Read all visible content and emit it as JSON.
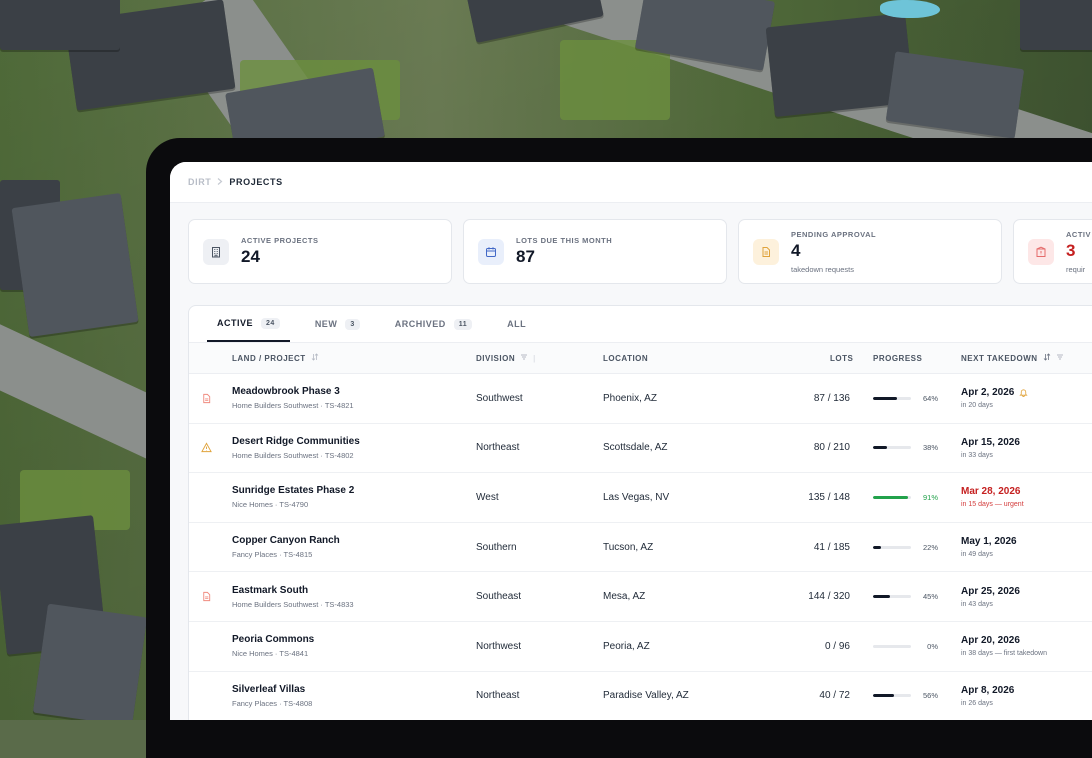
{
  "breadcrumb": {
    "root": "DIRT",
    "current": "PROJECTS"
  },
  "stats": [
    {
      "label": "ACTIVE PROJECTS",
      "value": "24",
      "sub": "",
      "icon": "building-icon"
    },
    {
      "label": "LOTS DUE THIS MONTH",
      "value": "87",
      "sub": "",
      "icon": "calendar-icon"
    },
    {
      "label": "PENDING APPROVAL",
      "value": "4",
      "sub": "takedown requests",
      "icon": "document-icon"
    },
    {
      "label": "ACTIV",
      "value": "3",
      "sub": "requir",
      "icon": "alert-building-icon"
    }
  ],
  "tabs": [
    {
      "label": "ACTIVE",
      "count": "24"
    },
    {
      "label": "NEW",
      "count": "3"
    },
    {
      "label": "ARCHIVED",
      "count": "11"
    },
    {
      "label": "ALL",
      "count": ""
    }
  ],
  "columns": {
    "project": "LAND / PROJECT",
    "division": "DIVISION",
    "location": "LOCATION",
    "lots": "LOTS",
    "progress": "PROGRESS",
    "takedown": "NEXT TAKEDOWN"
  },
  "rows": [
    {
      "name": "Meadowbrook Phase 3",
      "builder": "Home Builders Southwest",
      "code": "TS-4821",
      "division": "Southwest",
      "location": "Phoenix, AZ",
      "lots": "87 / 136",
      "progress": 64,
      "progress_label": "64%",
      "date": "Apr 2, 2026",
      "date_sub": "in 20 days",
      "status_icon": "document-icon",
      "bell": true,
      "urgent": false
    },
    {
      "name": "Desert Ridge Communities",
      "builder": "Home Builders Southwest",
      "code": "TS-4802",
      "division": "Northeast",
      "location": "Scottsdale, AZ",
      "lots": "80 / 210",
      "progress": 38,
      "progress_label": "38%",
      "date": "Apr 15, 2026",
      "date_sub": "in 33 days",
      "status_icon": "warning-icon",
      "bell": false,
      "urgent": false
    },
    {
      "name": "Sunridge Estates Phase 2",
      "builder": "Nice Homes",
      "code": "TS-4790",
      "division": "West",
      "location": "Las Vegas, NV",
      "lots": "135 / 148",
      "progress": 91,
      "progress_label": "91%",
      "date": "Mar 28, 2026",
      "date_sub": "in 15 days — urgent",
      "status_icon": "",
      "bell": false,
      "urgent": true
    },
    {
      "name": "Copper Canyon Ranch",
      "builder": "Fancy Places",
      "code": "TS-4815",
      "division": "Southern",
      "location": "Tucson, AZ",
      "lots": "41 / 185",
      "progress": 22,
      "progress_label": "22%",
      "date": "May 1, 2026",
      "date_sub": "in 49 days",
      "status_icon": "",
      "bell": false,
      "urgent": false
    },
    {
      "name": "Eastmark South",
      "builder": "Home Builders Southwest",
      "code": "TS-4833",
      "division": "Southeast",
      "location": "Mesa, AZ",
      "lots": "144 / 320",
      "progress": 45,
      "progress_label": "45%",
      "date": "Apr 25, 2026",
      "date_sub": "in 43 days",
      "status_icon": "document-icon",
      "bell": false,
      "urgent": false
    },
    {
      "name": "Peoria Commons",
      "builder": "Nice Homes",
      "code": "TS-4841",
      "division": "Northwest",
      "location": "Peoria, AZ",
      "lots": "0 / 96",
      "progress": 0,
      "progress_label": "0%",
      "date": "Apr 20, 2026",
      "date_sub": "in 38 days — first takedown",
      "status_icon": "",
      "bell": false,
      "urgent": false
    },
    {
      "name": "Silverleaf Villas",
      "builder": "Fancy Places",
      "code": "TS-4808",
      "division": "Northeast",
      "location": "Paradise Valley, AZ",
      "lots": "40 / 72",
      "progress": 56,
      "progress_label": "56%",
      "date": "Apr 8, 2026",
      "date_sub": "in 26 days",
      "status_icon": "",
      "bell": false,
      "urgent": false
    }
  ],
  "colors": {
    "accent": "#111827",
    "urgent": "#c52020",
    "success": "#22a24b",
    "warning": "#e0a33b"
  }
}
